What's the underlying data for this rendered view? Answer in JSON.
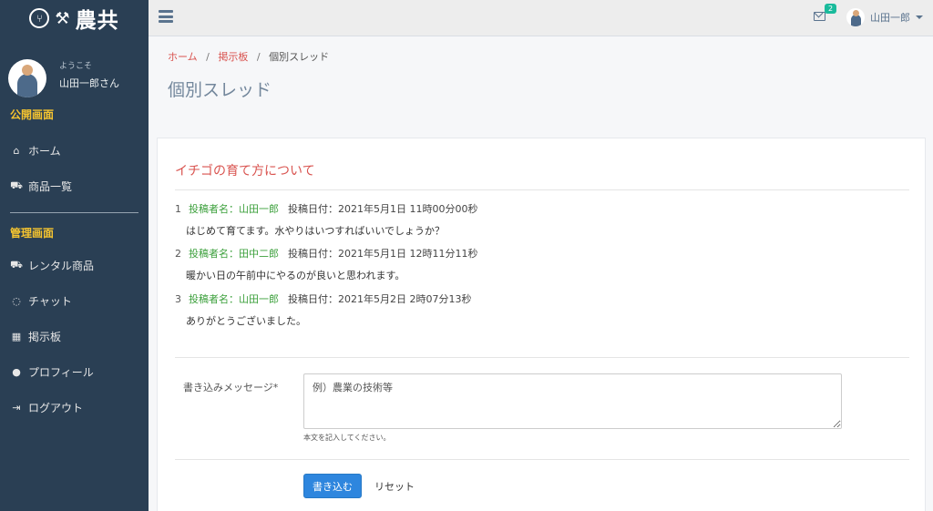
{
  "brand": {
    "name": "農共",
    "logo_icon": "utensils-icon"
  },
  "profile": {
    "welcome": "ようこそ",
    "name": "山田一郎さん"
  },
  "sidebar": {
    "public_title": "公開画面",
    "public_items": [
      {
        "label": "ホーム",
        "icon": "home-icon"
      },
      {
        "label": "商品一覧",
        "icon": "cart-icon"
      }
    ],
    "admin_title": "管理画面",
    "admin_items": [
      {
        "label": "レンタル商品",
        "icon": "cart-icon"
      },
      {
        "label": "チャット",
        "icon": "chat-icon"
      },
      {
        "label": "掲示板",
        "icon": "table-icon"
      },
      {
        "label": "プロフィール",
        "icon": "user-icon"
      },
      {
        "label": "ログアウト",
        "icon": "sign-out-icon"
      }
    ]
  },
  "topbar": {
    "mail_badge": "2",
    "user_name": "山田一郎"
  },
  "breadcrumb": {
    "home": "ホーム",
    "board": "掲示板",
    "current": "個別スレッド",
    "separator": "/"
  },
  "page_title": "個別スレッド",
  "thread": {
    "title": "イチゴの育て方について",
    "posts": [
      {
        "num": "1",
        "author": "投稿者名：山田一郎",
        "date": "投稿日付：2021年5月1日 11時00分00秒",
        "body": "はじめて育てます。水やりはいつすればいいでしょうか？"
      },
      {
        "num": "2",
        "author": "投稿者名：田中二郎",
        "date": "投稿日付：2021年5月1日 12時11分11秒",
        "body": "暖かい日の午前中にやるのが良いと思われます。"
      },
      {
        "num": "3",
        "author": "投稿者名：山田一郎",
        "date": "投稿日付：2021年5月2日 2時07分13秒",
        "body": "ありがとうございました。"
      }
    ]
  },
  "form": {
    "label": "書き込みメッセージ*",
    "placeholder": "例）農業の技術等",
    "help": "本文を記入してください。",
    "submit": "書き込む",
    "reset": "リセット"
  },
  "colors": {
    "sidebar_bg": "#2a3f54",
    "section_title": "#f5c430",
    "link_red": "#d9534f",
    "author_green": "#3ca03c",
    "primary": "#2e86de",
    "badge": "#1abb9c"
  }
}
